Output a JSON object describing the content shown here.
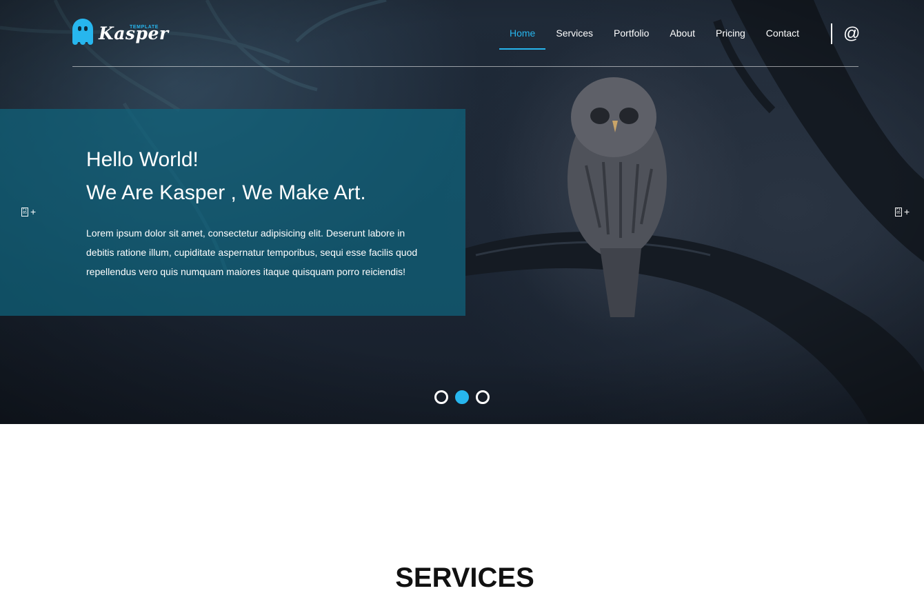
{
  "brand": {
    "name": "Kasper",
    "tag": "TEMPLATE",
    "accent": "#27b6ee"
  },
  "nav": {
    "items": [
      {
        "label": "Home",
        "active": true
      },
      {
        "label": "Services",
        "active": false
      },
      {
        "label": "Portfolio",
        "active": false
      },
      {
        "label": "About",
        "active": false
      },
      {
        "label": "Pricing",
        "active": false
      },
      {
        "label": "Contact",
        "active": false
      }
    ],
    "email_icon": "@"
  },
  "hero": {
    "title": "Hello World!",
    "subtitle": "We Are Kasper , We Make Art.",
    "description": "Lorem ipsum dolor sit amet, consectetur adipisicing elit. Deserunt labore in debitis ratione illum, cupiditate aspernatur temporibus, sequi esse facilis quod repellendus vero quis numquam maiores itaque quisquam porro reiciendis!",
    "prev_icon": "chevron-left-icon",
    "next_icon": "chevron-right-icon",
    "arrow_glyph": "F1 05",
    "arrow_plus": "+",
    "slides": [
      {
        "active": false
      },
      {
        "active": true
      },
      {
        "active": false
      }
    ]
  },
  "services": {
    "title": "SERVICES"
  }
}
